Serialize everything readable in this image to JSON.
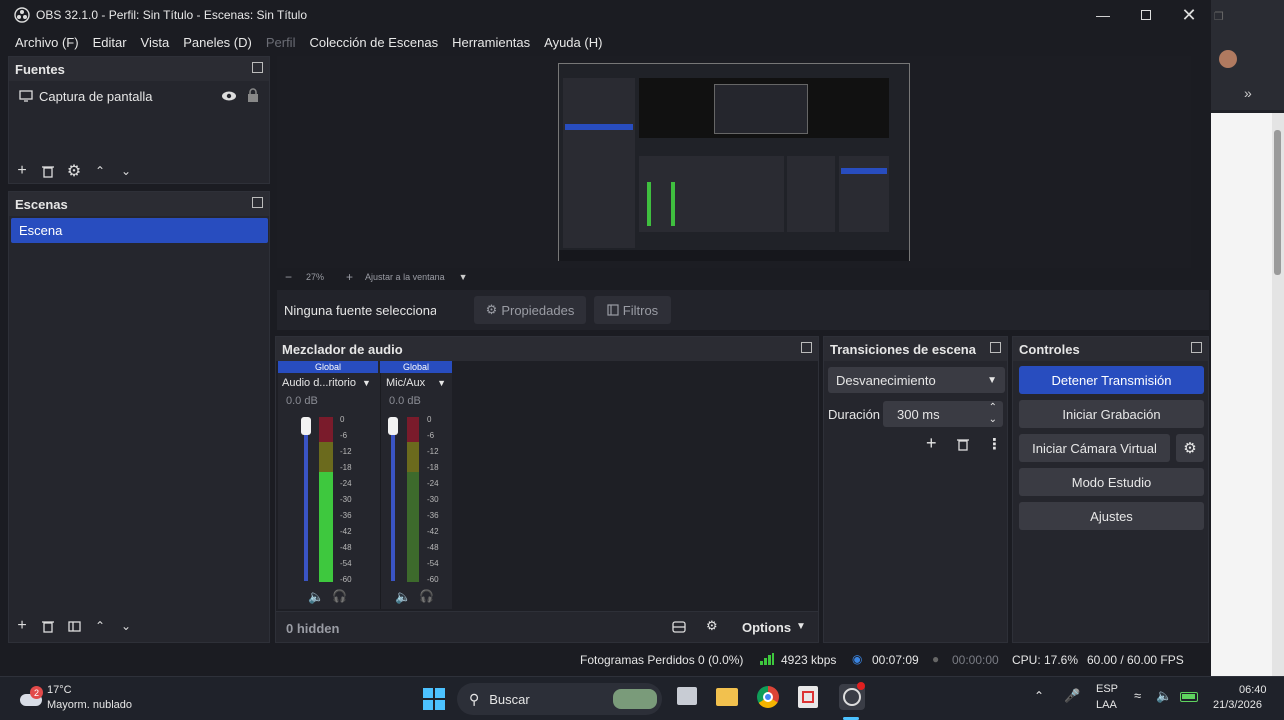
{
  "window": {
    "title": "OBS 32.1.0 - Perfil: Sin Título - Escenas: Sin Título"
  },
  "menu": [
    {
      "label": "Archivo (F)",
      "disabled": false
    },
    {
      "label": "Editar",
      "disabled": false
    },
    {
      "label": "Vista",
      "disabled": false
    },
    {
      "label": "Paneles (D)",
      "disabled": false
    },
    {
      "label": "Perfil",
      "disabled": true
    },
    {
      "label": "Colección de Escenas",
      "disabled": false
    },
    {
      "label": "Herramientas",
      "disabled": false
    },
    {
      "label": "Ayuda (H)",
      "disabled": false
    }
  ],
  "sources": {
    "title": "Fuentes",
    "items": [
      {
        "label": "Captura de pantalla"
      }
    ]
  },
  "scenes": {
    "title": "Escenas",
    "items": [
      {
        "label": "Escena",
        "selected": true
      }
    ]
  },
  "preview": {
    "zoom": "27%",
    "fit_label": "Ajustar a la ventana"
  },
  "source_bar": {
    "none_selected": "Ninguna fuente seleccionad",
    "properties": "Propiedades",
    "filters": "Filtros"
  },
  "mixer": {
    "title": "Mezclador de audio",
    "channels": [
      {
        "scope": "Global",
        "name": "Audio d...ritorio",
        "db": "0.0 dB"
      },
      {
        "scope": "Global",
        "name": "Mic/Aux",
        "db": "0.0 dB"
      }
    ],
    "ticks": [
      "0",
      "-6",
      "-12",
      "-18",
      "-24",
      "-30",
      "-36",
      "-42",
      "-48",
      "-54",
      "-60"
    ],
    "hidden_label": "0 hidden",
    "options_label": "Options"
  },
  "transitions": {
    "title": "Transiciones de escena",
    "selected": "Desvanecimiento",
    "duration_label": "Duración",
    "duration_value": "300 ms"
  },
  "controls": {
    "title": "Controles",
    "stop_stream": "Detener Transmisión",
    "start_record": "Iniciar Grabación",
    "virtual_cam": "Iniciar Cámara Virtual",
    "studio_mode": "Modo Estudio",
    "settings": "Ajustes"
  },
  "status": {
    "dropped": "Fotogramas Perdidos 0 (0.0%)",
    "bitrate": "4923 kbps",
    "stream_time": "00:07:09",
    "rec_time": "00:00:00",
    "cpu": "CPU: 17.6%",
    "fps": "60.00 / 60.00 FPS"
  },
  "taskbar": {
    "weather_temp": "17°C",
    "weather_desc": "Mayorm. nublado",
    "weather_badge": "2",
    "search_placeholder": "Buscar",
    "lang": "ESP",
    "layout": "LAA",
    "time": "06:40",
    "date": "21/3/2026"
  },
  "colors": {
    "accent": "#284dbf",
    "bg": "#1b1c22",
    "panel": "#25262d"
  }
}
